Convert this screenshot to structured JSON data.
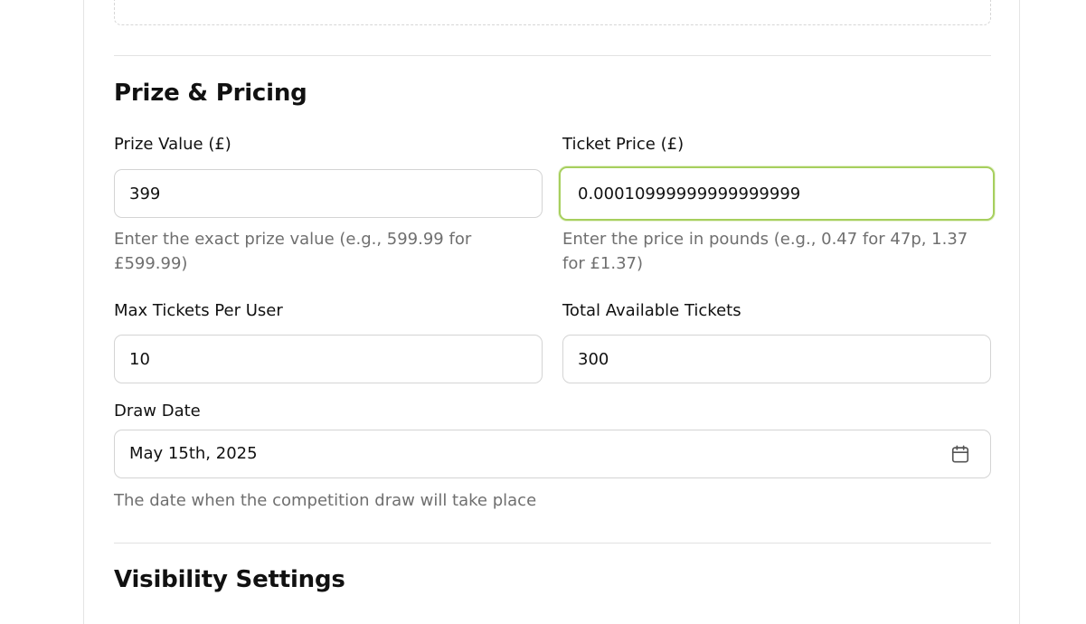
{
  "sections": {
    "prize_pricing_title": "Prize & Pricing",
    "visibility_title": "Visibility Settings"
  },
  "fields": {
    "prize_value": {
      "label": "Prize Value (£)",
      "value": "399",
      "help": "Enter the exact prize value (e.g., 599.99 for £599.99)"
    },
    "ticket_price": {
      "label": "Ticket Price (£)",
      "value": "0.00010999999999999999",
      "help": "Enter the price in pounds (e.g., 0.47 for 47p, 1.37 for £1.37)"
    },
    "max_tickets": {
      "label": "Max Tickets Per User",
      "value": "10"
    },
    "total_tickets": {
      "label": "Total Available Tickets",
      "value": "300"
    },
    "draw_date": {
      "label": "Draw Date",
      "value": "May 15th, 2025",
      "icon": "calendar-icon",
      "help": "The date when the competition draw will take place"
    }
  },
  "colors": {
    "focus_ring": "#a7cf5e",
    "help_text": "#6f6f6f",
    "border": "#d4d4d4"
  }
}
